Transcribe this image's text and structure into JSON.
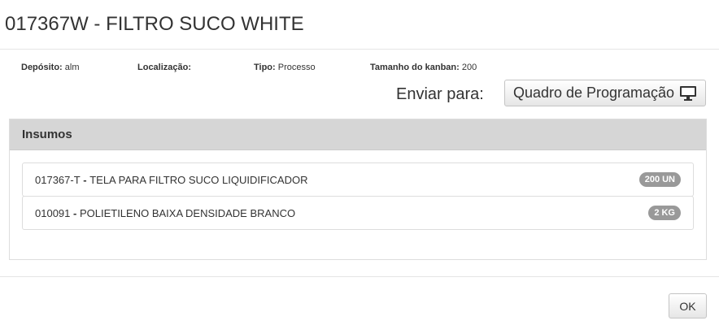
{
  "modal": {
    "title": "017367W - FILTRO SUCO WHITE"
  },
  "info": {
    "deposito_label": "Depósito:",
    "deposito_value": "alm",
    "localizacao_label": "Localização:",
    "localizacao_value": "",
    "tipo_label": "Tipo:",
    "tipo_value": "Processo",
    "kanban_label": "Tamanho do kanban:",
    "kanban_value": "200"
  },
  "send": {
    "label": "Enviar para:",
    "button_label": "Quadro de Programação",
    "button_icon": "monitor-icon"
  },
  "panel": {
    "title": "Insumos",
    "items": [
      {
        "code": "017367-T",
        "separator": " - ",
        "description": "TELA PARA FILTRO SUCO LIQUIDIFICADOR",
        "quantity": "200 UN"
      },
      {
        "code": "010091",
        "separator": " - ",
        "description": "POLIETILENO BAIXA DENSIDADE BRANCO",
        "quantity": "2 KG"
      }
    ]
  },
  "footer": {
    "ok_label": "OK"
  },
  "colors": {
    "panel_heading_bg": "#d6d6d6",
    "badge_bg": "#999999",
    "text": "#333333"
  }
}
